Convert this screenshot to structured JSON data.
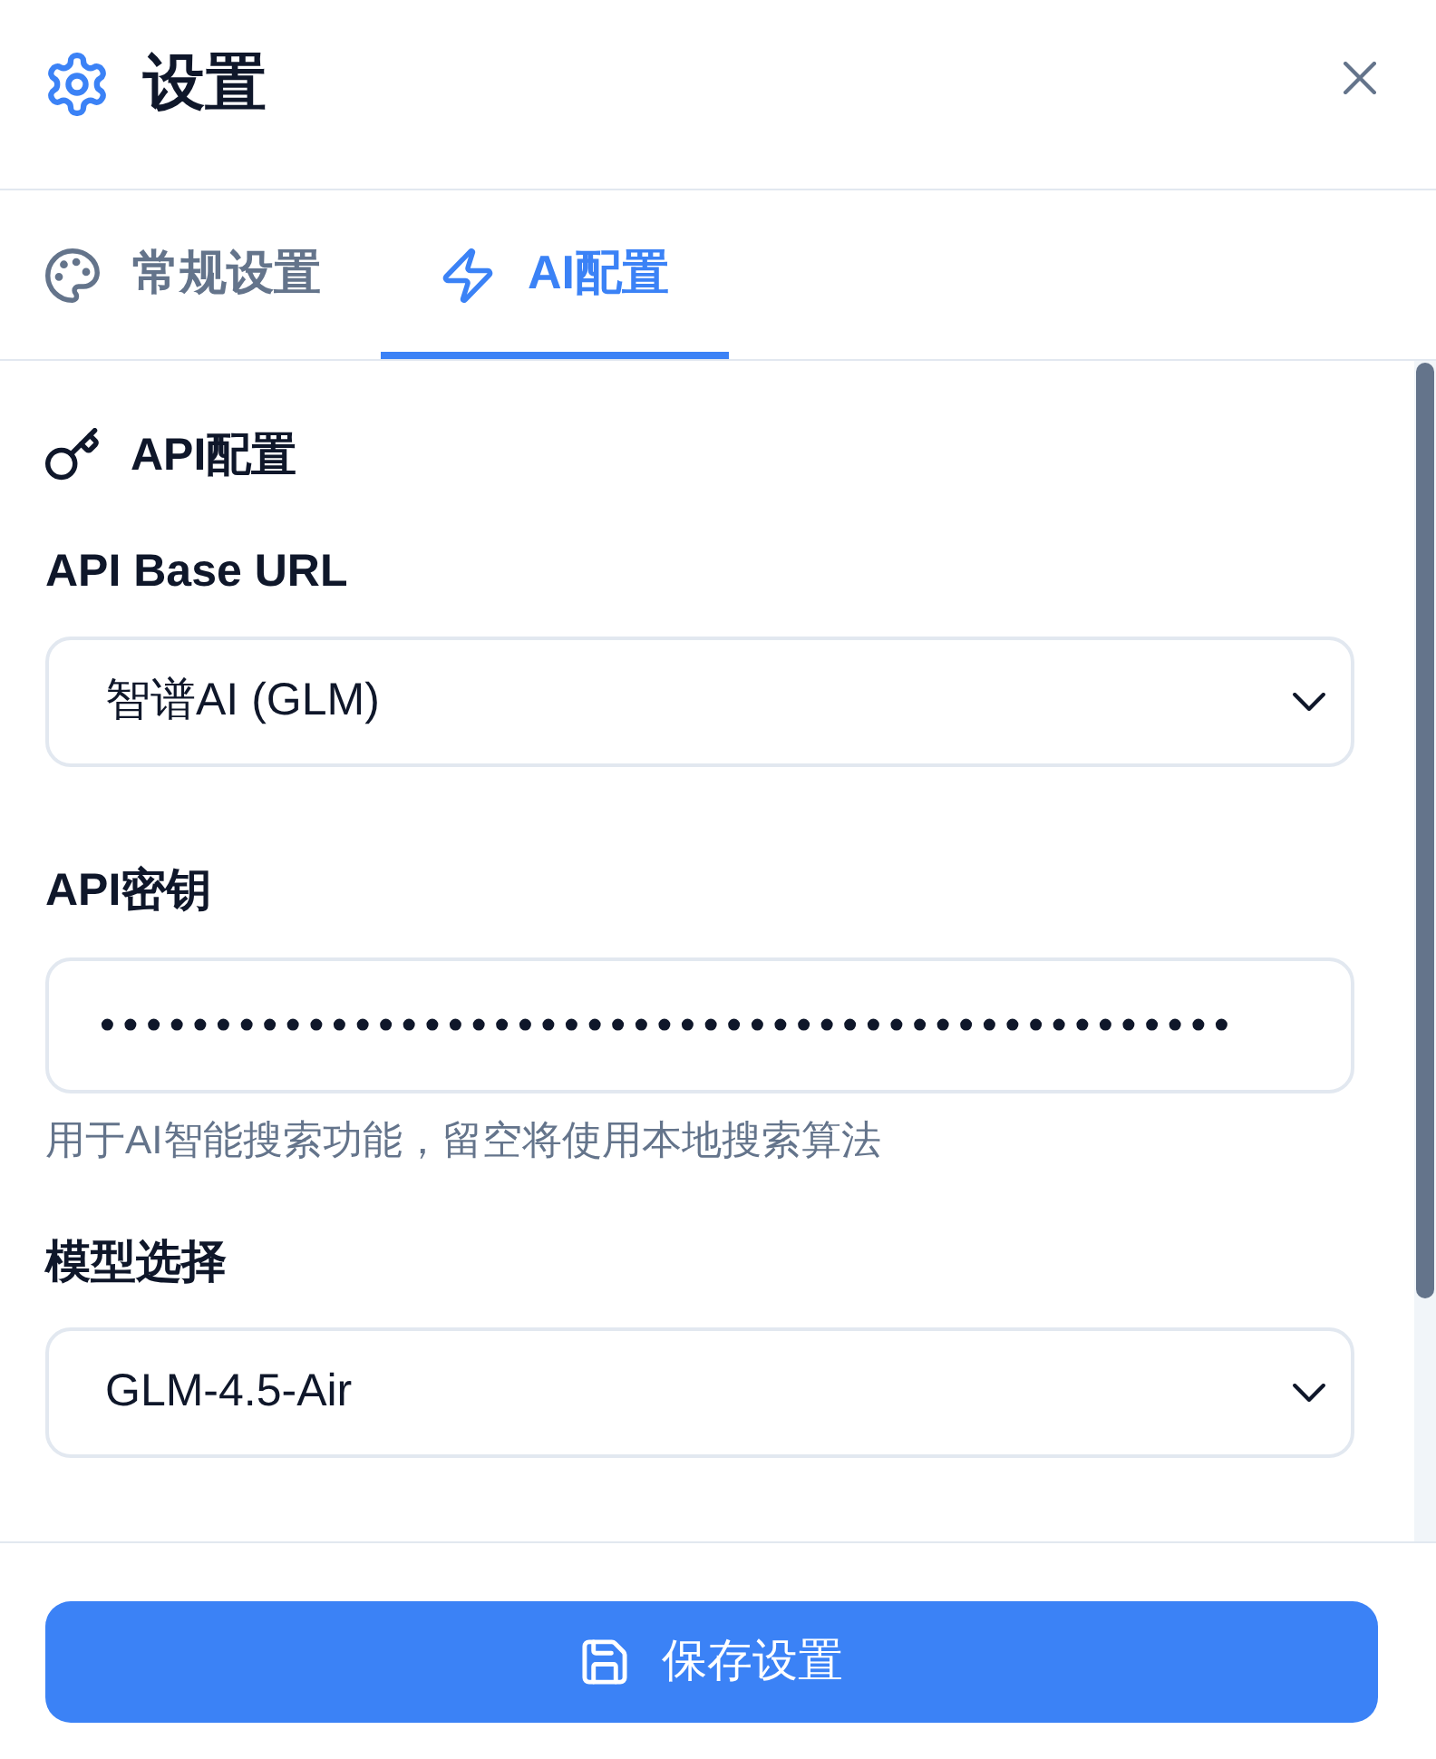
{
  "header": {
    "title": "设置"
  },
  "tabs": [
    {
      "label": "常规设置",
      "selected": false
    },
    {
      "label": "AI配置",
      "selected": true
    }
  ],
  "section": {
    "title": "API配置",
    "fields": [
      {
        "kind": "select",
        "label": "API Base URL",
        "value": "智谱AI (GLM)"
      },
      {
        "kind": "password",
        "label": "API密钥",
        "value": "•••••••••••••••••••••••••••••••••••••••••••••••••",
        "help_text": "用于AI智能搜索功能，留空将使用本地搜索算法"
      },
      {
        "kind": "select",
        "label": "模型选择",
        "value": "GLM-4.5-Air"
      }
    ]
  },
  "save_button": {
    "label": "保存设置"
  }
}
